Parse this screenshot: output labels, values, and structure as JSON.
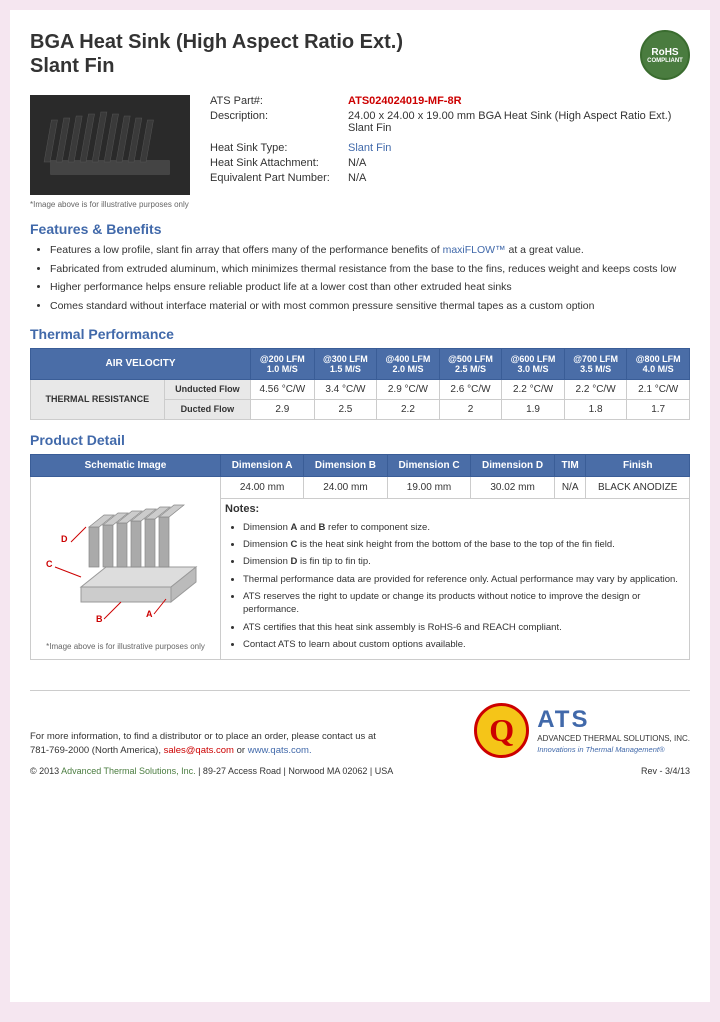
{
  "header": {
    "title_line1": "BGA Heat Sink (High Aspect Ratio Ext.)",
    "title_line2": "Slant Fin",
    "rohs": {
      "line1": "RoHS",
      "line2": "COMPLIANT"
    }
  },
  "product_info": {
    "ats_part_label": "ATS Part#:",
    "ats_part_value": "ATS024024019-MF-8R",
    "description_label": "Description:",
    "description_value": "24.00 x 24.00 x 19.00 mm BGA Heat Sink (High Aspect Ratio Ext.) Slant Fin",
    "heatsink_type_label": "Heat Sink Type:",
    "heatsink_type_value": "Slant Fin",
    "attachment_label": "Heat Sink Attachment:",
    "attachment_value": "N/A",
    "equiv_part_label": "Equivalent Part Number:",
    "equiv_part_value": "N/A",
    "image_note": "*Image above is for illustrative purposes only"
  },
  "features": {
    "section_title": "Features & Benefits",
    "items": [
      "Features a low profile, slant fin array that offers many of the performance benefits of maxiFLOW™ at a great value.",
      "Fabricated from extruded aluminum, which minimizes thermal resistance from the base to the fins, reduces weight and keeps costs low",
      "Higher performance helps ensure reliable product life at a lower cost than other extruded heat sinks",
      "Comes standard without interface material or with most common pressure sensitive thermal tapes as a custom option"
    ],
    "maxiflow_link": "maxiFLOW™"
  },
  "thermal_performance": {
    "section_title": "Thermal Performance",
    "table": {
      "air_velocity_label": "AIR VELOCITY",
      "columns": [
        {
          "lfm": "@200 LFM",
          "ms": "1.0 M/S"
        },
        {
          "lfm": "@300 LFM",
          "ms": "1.5 M/S"
        },
        {
          "lfm": "@400 LFM",
          "ms": "2.0 M/S"
        },
        {
          "lfm": "@500 LFM",
          "ms": "2.5 M/S"
        },
        {
          "lfm": "@600 LFM",
          "ms": "3.0 M/S"
        },
        {
          "lfm": "@700 LFM",
          "ms": "3.5 M/S"
        },
        {
          "lfm": "@800 LFM",
          "ms": "4.0 M/S"
        }
      ],
      "thermal_resistance_label": "THERMAL RESISTANCE",
      "unducted_label": "Unducted Flow",
      "unducted_values": [
        "4.56 °C/W",
        "3.4 °C/W",
        "2.9 °C/W",
        "2.6 °C/W",
        "2.2 °C/W",
        "2.2 °C/W",
        "2.1 °C/W"
      ],
      "ducted_label": "Ducted Flow",
      "ducted_values": [
        "2.9",
        "2.5",
        "2.2",
        "2",
        "1.9",
        "1.8",
        "1.7"
      ]
    }
  },
  "product_detail": {
    "section_title": "Product Detail",
    "table": {
      "headers": [
        "Schematic Image",
        "Dimension A",
        "Dimension B",
        "Dimension C",
        "Dimension D",
        "TIM",
        "Finish"
      ],
      "dim_a": "24.00 mm",
      "dim_b": "24.00 mm",
      "dim_c": "19.00 mm",
      "dim_d": "30.02 mm",
      "tim": "N/A",
      "finish": "BLACK ANODIZE",
      "schematic_note": "*Image above is for illustrative purposes only"
    },
    "notes": {
      "title": "Notes:",
      "items": [
        "Dimension A and B refer to component size.",
        "Dimension C is the heat sink height from the bottom of the base to the top of the fin field.",
        "Dimension D is fin tip to fin tip.",
        "Thermal performance data are provided for reference only. Actual performance may vary by application.",
        "ATS reserves the right to update or change its products without notice to improve the design or performance.",
        "ATS certifies that this heat sink assembly is RoHS-6 and REACH compliant.",
        "Contact ATS to learn about custom options available."
      ]
    }
  },
  "footer": {
    "contact_text": "For more information, to find a distributor or to place an order, please contact us at",
    "phone": "781-769-2000 (North America),",
    "email": "sales@qats.com",
    "email_or": "or",
    "website": "www.qats.com.",
    "copyright": "© 2013 Advanced Thermal Solutions, Inc. | 89-27 Access Road | Norwood MA  02062 | USA",
    "page_num": "Rev - 3/4/13",
    "ats_company": "ADVANCED\nTHERMAL\nSOLUTIONS, INC.",
    "ats_tagline": "Innovations in Thermal Management®"
  }
}
